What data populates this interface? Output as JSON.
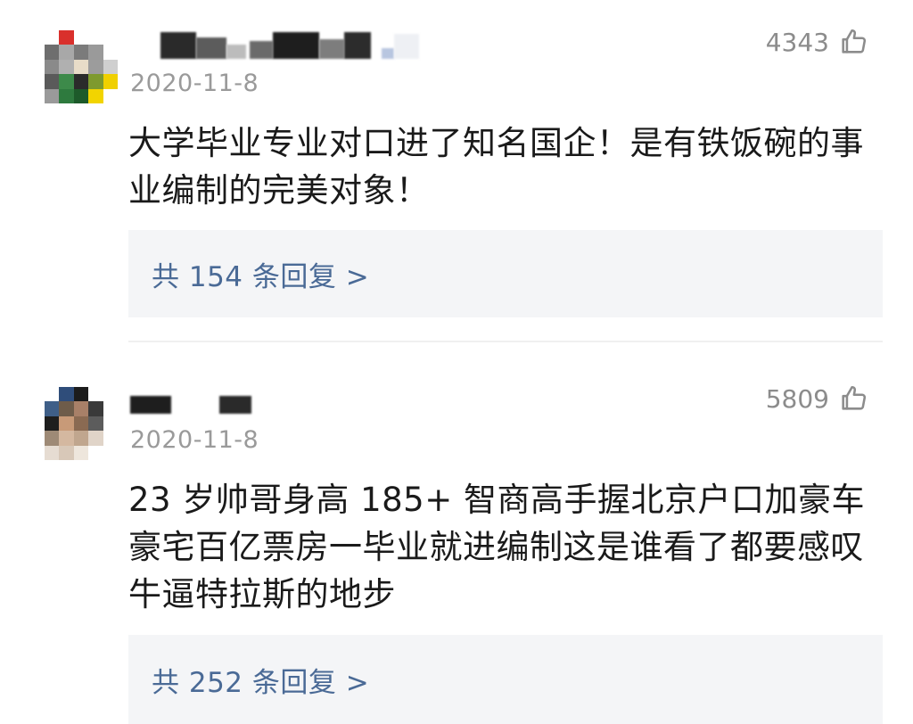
{
  "comments": [
    {
      "date": "2020-11-8",
      "likes": "4343",
      "text": "大学毕业专业对口进了知名国企！是有铁饭碗的事业编制的完美对象！",
      "replies_label": "共 154 条回复 >",
      "avatar_icon": "pixelated-avatar"
    },
    {
      "date": "2020-11-8",
      "likes": "5809",
      "text": "23 岁帅哥身高 185+ 智商高手握北京户口加豪车豪宅百亿票房一毕业就进编制这是谁看了都要感叹牛逼特拉斯的地步",
      "replies_label": "共 252 条回复 >",
      "avatar_icon": "pixelated-avatar"
    }
  ],
  "colors": {
    "date": "#9a9a9a",
    "likes": "#8c8c8c",
    "reply_link": "#4a6a96",
    "reply_bg": "#f4f5f7"
  }
}
